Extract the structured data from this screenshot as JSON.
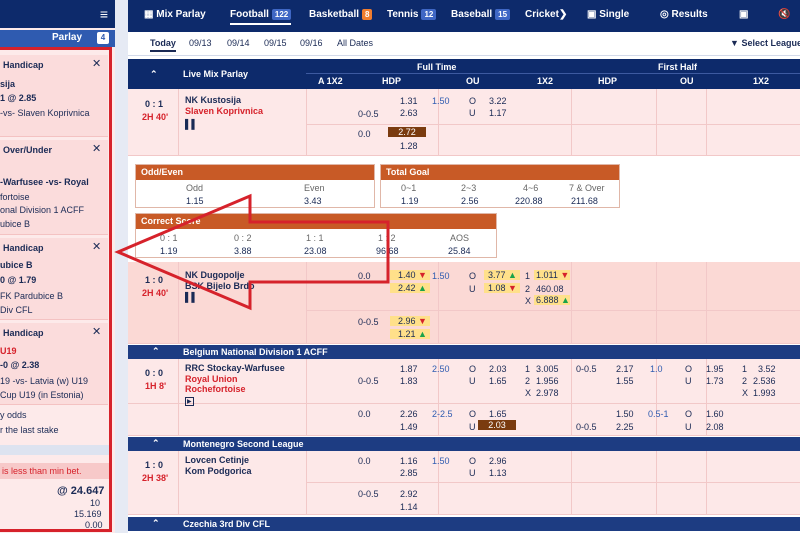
{
  "slip": {
    "parlay_label": "Parlay",
    "parlay_count": "4",
    "cards": [
      {
        "title": "Handicap",
        "lines": [
          "sija",
          "1 @ 2.85",
          "-vs- Slaven Koprivnica"
        ]
      },
      {
        "title": "Over/Under",
        "lines": [
          "0 @ 2.03",
          "-Warfusee -vs- Royal",
          "fortoise",
          "onal Division 1 ACFF"
        ]
      },
      {
        "title": "Handicap",
        "lines": [
          "ubice B",
          "0 @ 1.79",
          "FK Pardubice B",
          "Div CFL"
        ]
      },
      {
        "title": "Handicap",
        "lines": [
          "U19",
          "-0 @ 2.38",
          "19 -vs- Latvia (w) U19",
          "Cup U19 (in Estonia)"
        ]
      }
    ],
    "opt1": "y odds",
    "opt2": "r the last stake",
    "warning": "is less than min bet.",
    "total_odds": "@ 24.647",
    "stake": "10",
    "payout": "15.169",
    "zero": "0.00"
  },
  "nav": {
    "mix_parlay": "Mix Parlay",
    "football": "Football",
    "football_count": "122",
    "basketball": "Basketball",
    "basketball_count": "8",
    "tennis": "Tennis",
    "tennis_count": "12",
    "baseball": "Baseball",
    "baseball_count": "15",
    "cricket": "Cricket",
    "single": "Single",
    "results": "Results"
  },
  "dates": {
    "today": "Today",
    "d1": "09/13",
    "d2": "09/14",
    "d3": "09/15",
    "d4": "09/16",
    "all": "All Dates",
    "filter": "Select League"
  },
  "header": {
    "live": "Live Mix Parlay",
    "full_time": "Full Time",
    "first_half": "First Half",
    "a1x2": "A 1X2",
    "hdp": "HDP",
    "ou": "OU",
    "x12": "1X2",
    "hdp2": "HDP",
    "ou2": "OU",
    "x12b": "1X2"
  },
  "m1": {
    "score": "0 : 1",
    "time": "2H 40'",
    "home": "NK Kustosija",
    "away": "Slaven Koprivnica",
    "r1": {
      "hdp_line": "0-0.5",
      "h1": "1.31",
      "h2": "2.63",
      "ou_line": "1.50",
      "o": "O",
      "ov": "3.22",
      "u": "U",
      "uv": "1.17"
    },
    "r2": {
      "hdp_line": "0.0",
      "h1": "2.72",
      "h2": "1.28"
    }
  },
  "popup_oe": {
    "title": "Odd/Even",
    "odd": "Odd",
    "even": "Even",
    "odd_v": "1.15",
    "even_v": "3.43"
  },
  "popup_tg": {
    "title": "Total Goal",
    "c1": "0~1",
    "c2": "2~3",
    "c3": "4~6",
    "c4": "7 & Over",
    "v1": "1.19",
    "v2": "2.56",
    "v3": "220.88",
    "v4": "211.68"
  },
  "popup_cs": {
    "title": "Correct Score",
    "c1": "0 : 1",
    "c2": "0 : 2",
    "c3": "1 : 1",
    "c4": "1 : 2",
    "c5": "AOS",
    "v1": "1.19",
    "v2": "3.88",
    "v3": "23.08",
    "v4": "96.68",
    "v5": "25.84"
  },
  "m2": {
    "score": "1 : 0",
    "time": "2H 40'",
    "home": "NK Dugopolje",
    "away": "BSK Bijelo Brdo",
    "r1": {
      "hdp_line": "0.0",
      "h1": "1.40",
      "h2": "2.42",
      "ou_line": "1.50",
      "o": "O",
      "ov": "3.77",
      "u": "U",
      "uv": "1.08",
      "k1": "1",
      "x1": "1.011",
      "k2": "2",
      "x2": "460.08",
      "kx": "X",
      "xx": "6.888"
    },
    "r2": {
      "hdp_line": "0-0.5",
      "h1": "2.96",
      "h2": "1.21"
    }
  },
  "lg1": {
    "name": "Belgium National Division 1 ACFF"
  },
  "m3": {
    "score": "0 : 0",
    "time": "1H 8'",
    "home": "RRC Stockay-Warfusee",
    "away": "Royal Union Rochefortoise",
    "r1": {
      "hdp_line": "0-0.5",
      "h1": "1.87",
      "h2": "1.83",
      "ou_line": "2.50",
      "o": "O",
      "ov": "2.03",
      "u": "U",
      "uv": "1.65",
      "k1": "1",
      "x1": "3.005",
      "k2": "2",
      "x2": "1.956",
      "kx": "X",
      "xx": "2.978",
      "f_hdp": "0-0.5",
      "f_h1": "2.17",
      "f_h2": "1.55",
      "f_ou": "1.0",
      "f_o": "O",
      "f_ov": "1.95",
      "f_u": "U",
      "f_uv": "1.73",
      "f1": "1",
      "fx1": "3.52",
      "f2": "2",
      "fx2": "2.536",
      "fxk": "X",
      "fxx": "1.993"
    },
    "r2": {
      "hdp_line": "0.0",
      "h1": "2.26",
      "h2": "1.49",
      "ou_line": "2-2.5",
      "o": "O",
      "ov": "1.65",
      "u": "U",
      "uv": "2.03",
      "f_hdp": "0-0.5",
      "f_h1": "1.50",
      "f_h2": "2.25",
      "f_ou": "0.5-1",
      "f_o": "O",
      "f_ov": "1.60",
      "f_u": "U",
      "f_uv": "2.08"
    }
  },
  "lg2": {
    "name": "Montenegro Second League"
  },
  "m4": {
    "score": "1 : 0",
    "time": "2H 38'",
    "home": "Lovcen Cetinje",
    "away": "Kom Podgorica",
    "r1": {
      "hdp_line": "0.0",
      "h1": "1.16",
      "h2": "2.85",
      "ou_line": "1.50",
      "o": "O",
      "ov": "2.96",
      "u": "U",
      "uv": "1.13"
    },
    "r2": {
      "hdp_line": "0-0.5",
      "h1": "2.92",
      "h2": "1.14"
    }
  },
  "lg3": {
    "name": "Czechia 3rd Div CFL"
  },
  "colors": {
    "navy": "#0d2a6b",
    "accent": "#d6222b",
    "pink": "#fde8e8",
    "highlight": "#ffe08a"
  }
}
